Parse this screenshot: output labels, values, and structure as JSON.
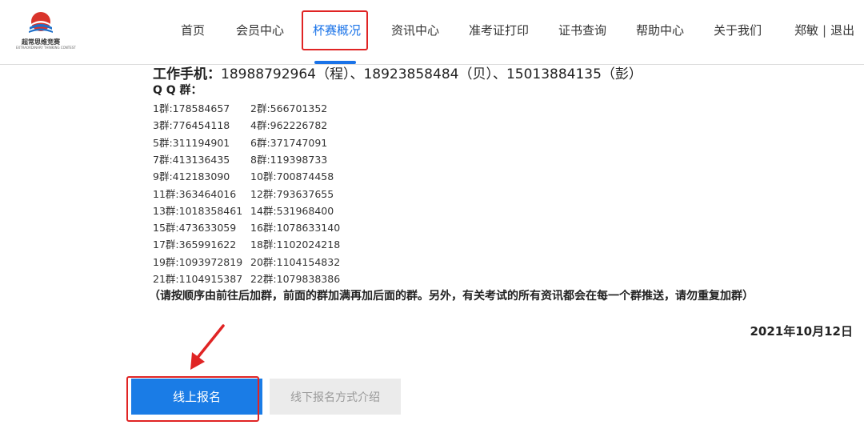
{
  "brand": {
    "name": "超常思维竞赛",
    "subtitle": "EXTRAORDINARY THINKING CONTEST"
  },
  "nav": {
    "items": [
      "首页",
      "会员中心",
      "杯赛概况",
      "资讯中心",
      "准考证打印",
      "证书查询",
      "帮助中心",
      "关于我们"
    ],
    "active_index": 2
  },
  "user": {
    "name": "郑敏",
    "separator": "|",
    "logout": "退出"
  },
  "contact": {
    "phone_label": "工作手机：",
    "phone_text": "18988792964（程）、18923858484（贝）、15013884135（彭）",
    "qq_title": "Q Q 群：",
    "qq_groups": [
      "1群:178584657",
      "2群:566701352",
      "3群:776454118",
      "4群:962226782",
      "5群:311194901",
      "6群:371747091",
      "7群:413136435",
      "8群:119398733",
      "9群:412183090",
      "10群:700874458",
      "11群:363464016",
      "12群:793637655",
      "13群:1018358461",
      "14群:531968400",
      "15群:473633059",
      "16群:1078633140",
      "17群:365991622",
      "18群:1102024218",
      "19群:1093972819",
      "20群:1104154832",
      "21群:1104915387",
      "22群:1079838386"
    ],
    "note": "（请按顺序由前往后加群，前面的群加满再加后面的群。另外，有关考试的所有资讯都会在每一个群推送，请勿重复加群）",
    "date": "2021年10月12日"
  },
  "buttons": {
    "online": "线上报名",
    "offline": "线下报名方式介绍"
  },
  "colors": {
    "accent": "#1a73e8",
    "annotation": "#e02424",
    "logo_red": "#d9342b",
    "logo_blue": "#1e6fc8"
  }
}
